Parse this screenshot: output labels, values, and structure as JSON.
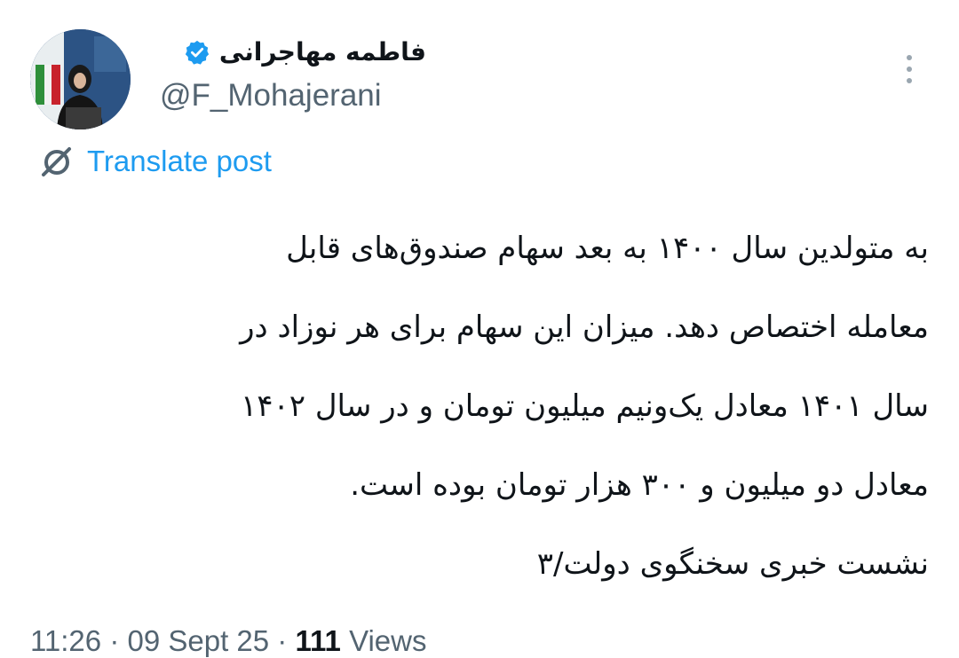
{
  "author": {
    "display_name": "فاطمه مهاجرانی",
    "handle": "@F_Mohajerani",
    "verified": true,
    "avatar_icon": "profile-photo"
  },
  "actions": {
    "translate_label": "Translate post",
    "more_icon": "more-vertical-icon"
  },
  "post": {
    "lines": [
      "به متولدین سال ۱۴۰۰ به بعد سهام صندوق‌های قابل",
      "معامله اختصاص دهد. میزان این سهام برای هر نوزاد در",
      "سال ۱۴۰۱ معادل یک‌ونیم میلیون تومان و در سال ۱۴۰۲",
      "معادل دو میلیون و ۳۰۰ هزار تومان بوده است.",
      "نشست خبری سخنگوی دولت/۳"
    ]
  },
  "meta": {
    "time": "11:26",
    "date": "09 Sept 25",
    "separator": "·",
    "views_count": "111",
    "views_label": "Views"
  },
  "colors": {
    "accent": "#1d9bf0",
    "text": "#0f1419",
    "muted": "#536471"
  }
}
